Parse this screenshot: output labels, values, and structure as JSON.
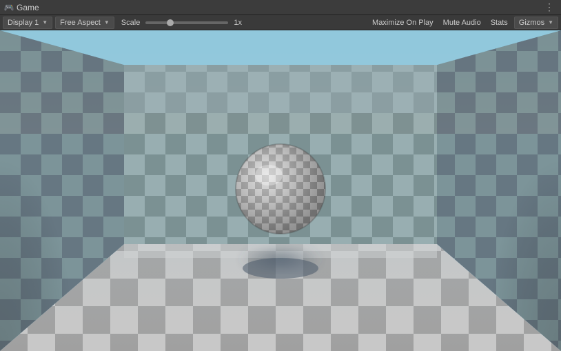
{
  "titlebar": {
    "icon": "🎮",
    "label": "Game",
    "menu_icon": "⋮"
  },
  "toolbar": {
    "display_label": "Display 1",
    "display_chevron": "▼",
    "aspect_label": "Free Aspect",
    "aspect_chevron": "▼",
    "scale_label": "Scale",
    "scale_value": "1x",
    "maximize_label": "Maximize On Play",
    "mute_label": "Mute Audio",
    "stats_label": "Stats",
    "gizmos_label": "Gizmos",
    "gizmos_chevron": "▼"
  },
  "viewport": {
    "background_color": "#87ceeb"
  }
}
